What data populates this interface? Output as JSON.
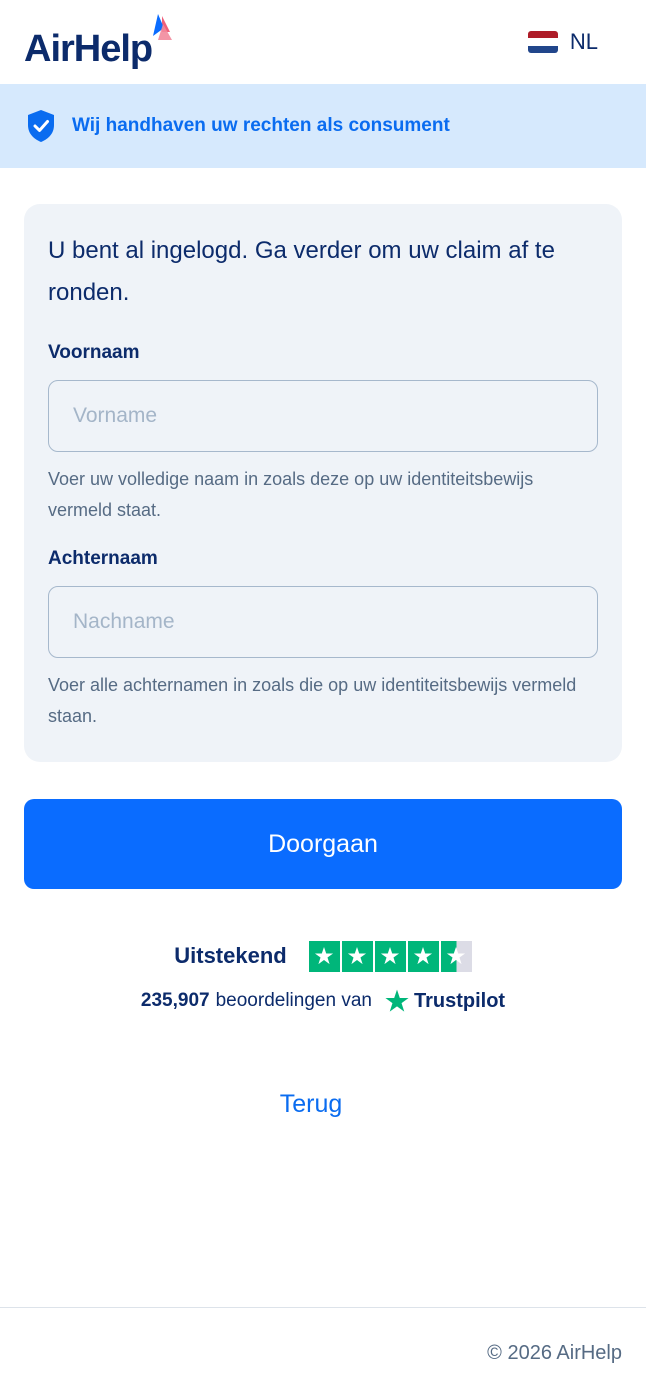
{
  "header": {
    "logo_text": "AirHelp",
    "language": {
      "code": "NL",
      "flag_colors": [
        "#ae1c28",
        "#ffffff",
        "#21468b"
      ]
    }
  },
  "banner": {
    "icon": "shield-check-icon",
    "text": "Wij handhaven uw rechten als consument"
  },
  "form": {
    "title": "U bent al ingelogd. Ga verder om uw claim af te ronden.",
    "first_name": {
      "label": "Voornaam",
      "placeholder": "Vorname",
      "value": "",
      "hint": "Voer uw volledige naam in zoals deze op uw identiteitsbewijs vermeld staat."
    },
    "last_name": {
      "label": "Achternaam",
      "placeholder": "Nachname",
      "value": "",
      "hint": "Voer alle achternamen in zoals die op uw identiteitsbewijs vermeld staan."
    },
    "submit_label": "Doorgaan"
  },
  "trustpilot": {
    "rating_label": "Uitstekend",
    "stars": 4.5,
    "star_color": "#00b67a",
    "review_count": "235,907",
    "reviews_text": "beoordelingen van",
    "brand": "Trustpilot"
  },
  "back_label": "Terug",
  "footer": {
    "copyright": "© 2026 AirHelp"
  },
  "colors": {
    "primary": "#0a6cff",
    "navy": "#0c2b6b",
    "banner_bg": "#d6e9fd"
  }
}
